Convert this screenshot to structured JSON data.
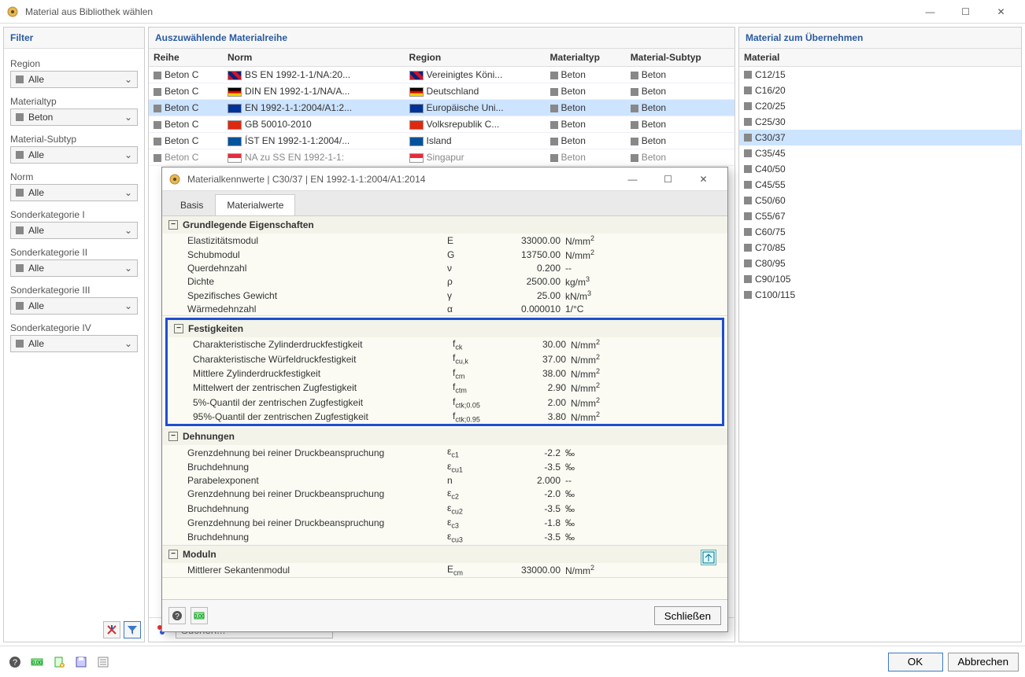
{
  "window": {
    "title": "Material aus Bibliothek wählen"
  },
  "filter": {
    "header": "Filter",
    "groups": [
      {
        "label": "Region",
        "value": "Alle"
      },
      {
        "label": "Materialtyp",
        "value": "Beton"
      },
      {
        "label": "Material-Subtyp",
        "value": "Alle"
      },
      {
        "label": "Norm",
        "value": "Alle"
      },
      {
        "label": "Sonderkategorie I",
        "value": "Alle"
      },
      {
        "label": "Sonderkategorie II",
        "value": "Alle"
      },
      {
        "label": "Sonderkategorie III",
        "value": "Alle"
      },
      {
        "label": "Sonderkategorie IV",
        "value": "Alle"
      }
    ]
  },
  "series": {
    "header": "Auszuwählende Materialreihe",
    "cols": [
      "Reihe",
      "Norm",
      "Region",
      "Materialtyp",
      "Material-Subtyp"
    ],
    "rows": [
      {
        "reihe": "Beton C",
        "norm": "BS EN 1992-1-1/NA:20...",
        "region": "Vereinigtes Köni...",
        "typ": "Beton",
        "sub": "Beton",
        "flag": "uk",
        "sel": false,
        "dim": false
      },
      {
        "reihe": "Beton C",
        "norm": "DIN EN 1992-1-1/NA/A...",
        "region": "Deutschland",
        "typ": "Beton",
        "sub": "Beton",
        "flag": "de",
        "sel": false,
        "dim": false
      },
      {
        "reihe": "Beton C",
        "norm": "EN 1992-1-1:2004/A1:2...",
        "region": "Europäische Uni...",
        "typ": "Beton",
        "sub": "Beton",
        "flag": "eu",
        "sel": true,
        "dim": false
      },
      {
        "reihe": "Beton C",
        "norm": "GB 50010-2010",
        "region": "Volksrepublik C...",
        "typ": "Beton",
        "sub": "Beton",
        "flag": "cn",
        "sel": false,
        "dim": false
      },
      {
        "reihe": "Beton C",
        "norm": "ÍST EN 1992-1-1:2004/...",
        "region": "Island",
        "typ": "Beton",
        "sub": "Beton",
        "flag": "is",
        "sel": false,
        "dim": false
      },
      {
        "reihe": "Beton C",
        "norm": "NA zu SS EN 1992-1-1:",
        "region": "Singapur",
        "typ": "Beton",
        "sub": "Beton",
        "flag": "sg",
        "sel": false,
        "dim": true
      }
    ]
  },
  "materials": {
    "header": "Material zum Übernehmen",
    "col": "Material",
    "items": [
      {
        "name": "C12/15"
      },
      {
        "name": "C16/20"
      },
      {
        "name": "C20/25"
      },
      {
        "name": "C25/30"
      },
      {
        "name": "C30/37",
        "selected": true
      },
      {
        "name": "C35/45"
      },
      {
        "name": "C40/50"
      },
      {
        "name": "C45/55"
      },
      {
        "name": "C50/60"
      },
      {
        "name": "C55/67"
      },
      {
        "name": "C60/75"
      },
      {
        "name": "C70/85"
      },
      {
        "name": "C80/95"
      },
      {
        "name": "C90/105"
      },
      {
        "name": "C100/115"
      }
    ]
  },
  "dialog": {
    "title": "Materialkennwerte | C30/37 | EN 1992-1-1:2004/A1:2014",
    "tabs": {
      "basis": "Basis",
      "werte": "Materialwerte"
    },
    "groups": [
      {
        "name": "Grundlegende Eigenschaften",
        "rows": [
          {
            "n": "Elastizitätsmodul",
            "s": "E",
            "v": "33000.00",
            "u": "N/mm²"
          },
          {
            "n": "Schubmodul",
            "s": "G",
            "v": "13750.00",
            "u": "N/mm²"
          },
          {
            "n": "Querdehnzahl",
            "s": "ν",
            "v": "0.200",
            "u": "--"
          },
          {
            "n": "Dichte",
            "s": "ρ",
            "v": "2500.00",
            "u": "kg/m³"
          },
          {
            "n": "Spezifisches Gewicht",
            "s": "γ",
            "v": "25.00",
            "u": "kN/m³"
          },
          {
            "n": "Wärmedehnzahl",
            "s": "α",
            "v": "0.000010",
            "u": "1/°C"
          }
        ]
      },
      {
        "name": "Festigkeiten",
        "highlight": true,
        "rows": [
          {
            "n": "Charakteristische Zylinderdruckfestigkeit",
            "s": "f_ck",
            "v": "30.00",
            "u": "N/mm²"
          },
          {
            "n": "Charakteristische Würfeldruckfestigkeit",
            "s": "f_cu,k",
            "v": "37.00",
            "u": "N/mm²"
          },
          {
            "n": "Mittlere Zylinderdruckfestigkeit",
            "s": "f_cm",
            "v": "38.00",
            "u": "N/mm²"
          },
          {
            "n": "Mittelwert der zentrischen Zugfestigkeit",
            "s": "f_ctm",
            "v": "2.90",
            "u": "N/mm²"
          },
          {
            "n": "5%-Quantil der zentrischen Zugfestigkeit",
            "s": "f_ctk;0.05",
            "v": "2.00",
            "u": "N/mm²"
          },
          {
            "n": "95%-Quantil der zentrischen Zugfestigkeit",
            "s": "f_ctk;0.95",
            "v": "3.80",
            "u": "N/mm²"
          }
        ]
      },
      {
        "name": "Dehnungen",
        "rows": [
          {
            "n": "Grenzdehnung bei reiner Druckbeanspruchung",
            "s": "ε_c1",
            "v": "-2.2",
            "u": "‰"
          },
          {
            "n": "Bruchdehnung",
            "s": "ε_cu1",
            "v": "-3.5",
            "u": "‰"
          },
          {
            "n": "Parabelexponent",
            "s": "n",
            "v": "2.000",
            "u": "--"
          },
          {
            "n": "Grenzdehnung bei reiner Druckbeanspruchung",
            "s": "ε_c2",
            "v": "-2.0",
            "u": "‰"
          },
          {
            "n": "Bruchdehnung",
            "s": "ε_cu2",
            "v": "-3.5",
            "u": "‰"
          },
          {
            "n": "Grenzdehnung bei reiner Druckbeanspruchung",
            "s": "ε_c3",
            "v": "-1.8",
            "u": "‰"
          },
          {
            "n": "Bruchdehnung",
            "s": "ε_cu3",
            "v": "-3.5",
            "u": "‰"
          }
        ]
      },
      {
        "name": "Moduln",
        "rows": [
          {
            "n": "Mittlerer Sekantenmodul",
            "s": "E_cm",
            "v": "33000.00",
            "u": "N/mm²"
          }
        ]
      }
    ],
    "close": "Schließen"
  },
  "search": {
    "placeholder": "Suchen..."
  },
  "footer": {
    "ok": "OK",
    "cancel": "Abbrechen"
  }
}
